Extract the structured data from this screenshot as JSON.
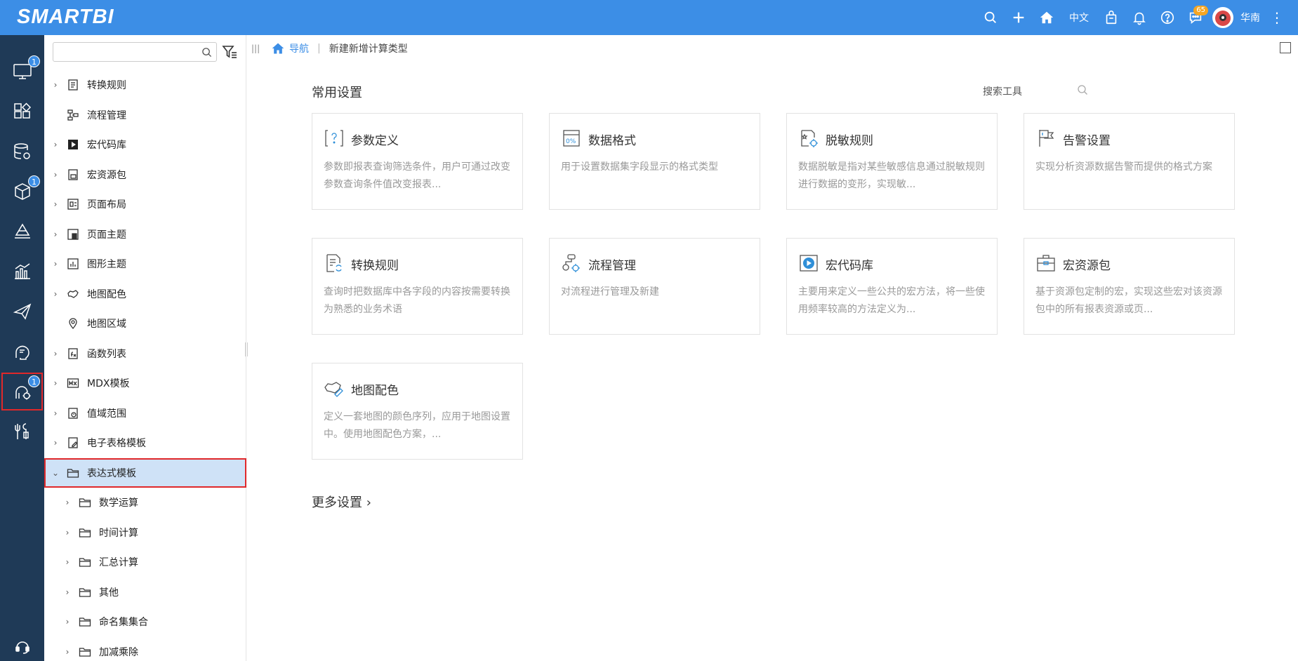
{
  "app": {
    "logo": "SMARTBI"
  },
  "topbar": {
    "lang": "中文",
    "message_count": "65",
    "user_name": "华南",
    "icons": [
      "search-icon",
      "plus-icon",
      "home-icon",
      "bag-icon",
      "bell-icon",
      "help-icon",
      "message-icon",
      "more-icon"
    ]
  },
  "rail": {
    "items": [
      {
        "name": "dashboard",
        "badge": "1"
      },
      {
        "name": "analysis",
        "badge": ""
      },
      {
        "name": "data",
        "badge": ""
      },
      {
        "name": "model",
        "badge": "1"
      },
      {
        "name": "mining",
        "badge": ""
      },
      {
        "name": "report",
        "badge": ""
      },
      {
        "name": "publish",
        "badge": ""
      },
      {
        "name": "brain",
        "badge": ""
      },
      {
        "name": "custom",
        "badge": "1"
      },
      {
        "name": "tools",
        "badge": ""
      }
    ],
    "help_label": "答疑"
  },
  "tree": {
    "search_placeholder": "",
    "items": [
      {
        "label": "转换规则",
        "level": 0,
        "has_children": true,
        "icon": "rule-icon"
      },
      {
        "label": "流程管理",
        "level": 0,
        "has_children": false,
        "icon": "flow-icon"
      },
      {
        "label": "宏代码库",
        "level": 0,
        "has_children": true,
        "icon": "macro-icon"
      },
      {
        "label": "宏资源包",
        "level": 0,
        "has_children": true,
        "icon": "package-icon"
      },
      {
        "label": "页面布局",
        "level": 0,
        "has_children": true,
        "icon": "layout-icon"
      },
      {
        "label": "页面主题",
        "level": 0,
        "has_children": true,
        "icon": "theme-icon"
      },
      {
        "label": "图形主题",
        "level": 0,
        "has_children": true,
        "icon": "chart-theme-icon"
      },
      {
        "label": "地图配色",
        "level": 0,
        "has_children": true,
        "icon": "map-color-icon"
      },
      {
        "label": "地图区域",
        "level": 0,
        "has_children": false,
        "icon": "map-pin-icon"
      },
      {
        "label": "函数列表",
        "level": 0,
        "has_children": true,
        "icon": "function-icon"
      },
      {
        "label": "MDX模板",
        "level": 0,
        "has_children": true,
        "icon": "mdx-icon"
      },
      {
        "label": "值域范围",
        "level": 0,
        "has_children": true,
        "icon": "range-icon"
      },
      {
        "label": "电子表格模板",
        "level": 0,
        "has_children": true,
        "icon": "sheet-icon"
      },
      {
        "label": "表达式模板",
        "level": 0,
        "has_children": true,
        "expanded": true,
        "selected": true,
        "icon": "folder-icon"
      },
      {
        "label": "数学运算",
        "level": 1,
        "has_children": true,
        "icon": "folder-icon"
      },
      {
        "label": "时间计算",
        "level": 1,
        "has_children": true,
        "icon": "folder-icon"
      },
      {
        "label": "汇总计算",
        "level": 1,
        "has_children": true,
        "icon": "folder-icon"
      },
      {
        "label": "其他",
        "level": 1,
        "has_children": true,
        "icon": "folder-icon"
      },
      {
        "label": "命名集集合",
        "level": 1,
        "has_children": true,
        "icon": "folder-icon"
      },
      {
        "label": "加减乘除",
        "level": 1,
        "has_children": true,
        "icon": "folder-icon"
      }
    ]
  },
  "breadcrumb": {
    "nav": "导航",
    "current": "新建新增计算类型"
  },
  "main": {
    "section_title": "常用设置",
    "search_tool": "搜索工具",
    "cards": [
      {
        "title": "参数定义",
        "desc": "参数即报表查询筛选条件，用户可通过改变参数查询条件值改变报表...",
        "icon": "param-icon"
      },
      {
        "title": "数据格式",
        "desc": "用于设置数据集字段显示的格式类型",
        "icon": "format-icon"
      },
      {
        "title": "脱敏规则",
        "desc": "数据脱敏是指对某些敏感信息通过脱敏规则进行数据的变形，实现敏...",
        "icon": "mask-icon"
      },
      {
        "title": "告警设置",
        "desc": "实现分析资源数据告警而提供的格式方案",
        "icon": "alarm-icon"
      },
      {
        "title": "转换规则",
        "desc": "查询时把数据库中各字段的内容按需要转换为熟悉的业务术语",
        "icon": "convert-icon"
      },
      {
        "title": "流程管理",
        "desc": "对流程进行管理及新建",
        "icon": "process-icon"
      },
      {
        "title": "宏代码库",
        "desc": "主要用来定义一些公共的宏方法，将一些使用频率较高的方法定义为...",
        "icon": "macro-lib-icon"
      },
      {
        "title": "宏资源包",
        "desc": "基于资源包定制的宏，实现这些宏对该资源包中的所有报表资源或页...",
        "icon": "resource-pack-icon"
      },
      {
        "title": "地图配色",
        "desc": "定义一套地图的颜色序列，应用于地图设置中。使用地图配色方案，...",
        "icon": "map-palette-icon"
      }
    ],
    "more_settings": "更多设置"
  },
  "colors": {
    "brand": "#3c8ee6",
    "rail_bg": "#1f3a57",
    "highlight": "#e0282a",
    "selected_bg": "#cfe2f7"
  }
}
